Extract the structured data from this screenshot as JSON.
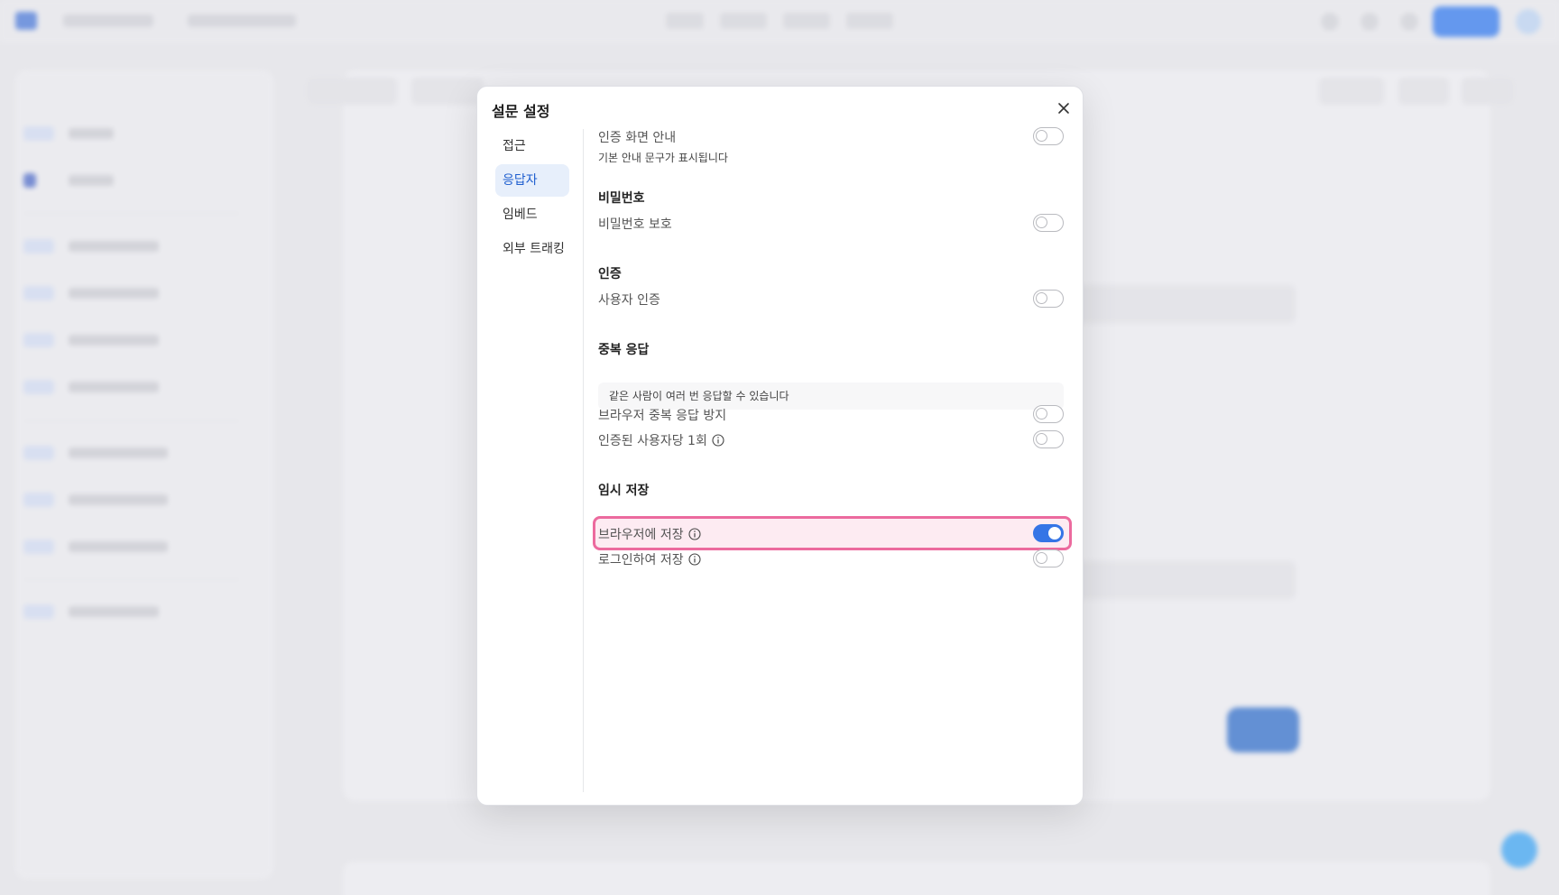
{
  "modal": {
    "title": "설문 설정",
    "nav": [
      {
        "label": "접근",
        "active": false
      },
      {
        "label": "응답자",
        "active": true
      },
      {
        "label": "임베드",
        "active": false
      },
      {
        "label": "외부 트래킹",
        "active": false
      }
    ],
    "auth_screen": {
      "label": "인증 화면 안내",
      "description": "기본 안내 문구가 표시됩니다",
      "enabled": false
    },
    "password": {
      "section_title": "비밀번호",
      "label": "비밀번호 보호",
      "enabled": false
    },
    "authentication": {
      "section_title": "인증",
      "label": "사용자 인증",
      "enabled": false
    },
    "duplicate": {
      "section_title": "중복 응답",
      "notice": "같은 사람이 여러 번 응답할 수 있습니다",
      "browser_label": "브라우저 중복 응답 방지",
      "browser_enabled": false,
      "per_user_label": "인증된 사용자당 1회",
      "per_user_enabled": false
    },
    "temp_save": {
      "section_title": "임시 저장",
      "browser_label": "브라우저에 저장",
      "browser_enabled": true,
      "login_label": "로그인하여 저장",
      "login_enabled": false
    }
  },
  "colors": {
    "accent": "#3575e6",
    "highlight_border": "#ec6a9e",
    "highlight_fill": "#fdebf2",
    "nav_active_bg": "#e7effb"
  }
}
